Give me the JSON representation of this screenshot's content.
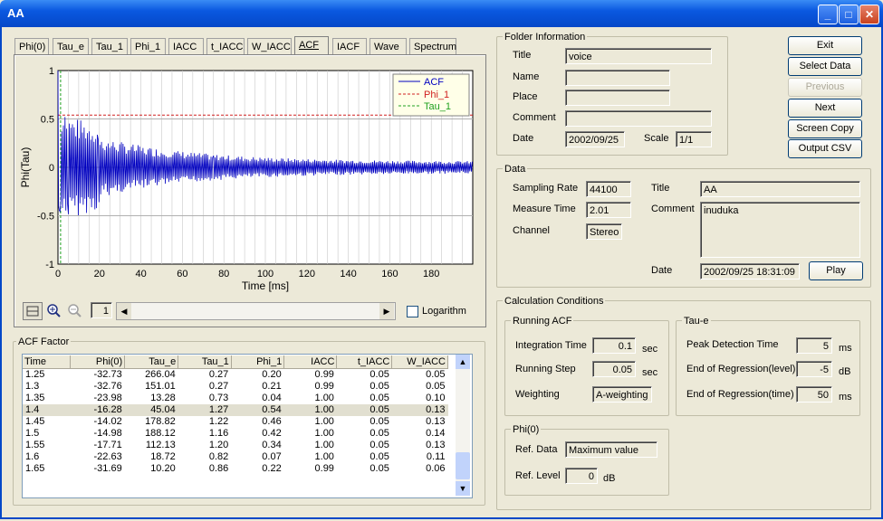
{
  "window": {
    "title": "AA"
  },
  "tabs": [
    "Phi(0)",
    "Tau_e",
    "Tau_1",
    "Phi_1",
    "IACC",
    "t_IACC",
    "W_IACC",
    "ACF",
    "IACF",
    "Wave",
    "Spectrum"
  ],
  "active_tab": "ACF",
  "chart_data": {
    "type": "line",
    "xlabel": "Time [ms]",
    "ylabel": "Phi(Tau)",
    "xlim": [
      0,
      200
    ],
    "ylim": [
      -1,
      1
    ],
    "xticks": [
      "0",
      "20",
      "40",
      "60",
      "80",
      "100",
      "120",
      "140",
      "160",
      "180"
    ],
    "yticks": [
      "1",
      "0.5",
      "0",
      "-0.5",
      "-1"
    ],
    "grid": true,
    "legend_position": "top-right",
    "series": [
      {
        "name": "ACF",
        "color": "#0000c0",
        "style": "solid",
        "description_envelope": {
          "start": 0.45,
          "decay_ms": 60,
          "oscillation_period_ms": 1.8
        }
      },
      {
        "name": "Phi_1",
        "color": "#d02020",
        "style": "dashed",
        "y": 0.54
      },
      {
        "name": "Tau_1",
        "color": "#20a020",
        "style": "dashed",
        "x": 1.27
      }
    ]
  },
  "toolbar": {
    "page_value": "1",
    "logarithm_label": "Logarithm"
  },
  "acf_factor": {
    "title": "ACF Factor",
    "columns": [
      "Time",
      "Phi(0)",
      "Tau_e",
      "Tau_1",
      "Phi_1",
      "IACC",
      "t_IACC",
      "W_IACC"
    ],
    "rows": [
      [
        "1.25",
        "-32.73",
        "266.04",
        "0.27",
        "0.20",
        "0.99",
        "0.05",
        "0.05"
      ],
      [
        "1.3",
        "-32.76",
        "151.01",
        "0.27",
        "0.21",
        "0.99",
        "0.05",
        "0.05"
      ],
      [
        "1.35",
        "-23.98",
        "13.28",
        "0.73",
        "0.04",
        "1.00",
        "0.05",
        "0.10"
      ],
      [
        "1.4",
        "-16.28",
        "45.04",
        "1.27",
        "0.54",
        "1.00",
        "0.05",
        "0.13"
      ],
      [
        "1.45",
        "-14.02",
        "178.82",
        "1.22",
        "0.46",
        "1.00",
        "0.05",
        "0.13"
      ],
      [
        "1.5",
        "-14.98",
        "188.12",
        "1.16",
        "0.42",
        "1.00",
        "0.05",
        "0.14"
      ],
      [
        "1.55",
        "-17.71",
        "112.13",
        "1.20",
        "0.34",
        "1.00",
        "0.05",
        "0.13"
      ],
      [
        "1.6",
        "-22.63",
        "18.72",
        "0.82",
        "0.07",
        "1.00",
        "0.05",
        "0.11"
      ],
      [
        "1.65",
        "-31.69",
        "10.20",
        "0.86",
        "0.22",
        "0.99",
        "0.05",
        "0.06"
      ]
    ],
    "selected_row": 3
  },
  "folder_info": {
    "title": "Folder Information",
    "title_label": "Title",
    "title_value": "voice",
    "name_label": "Name",
    "name_value": "",
    "place_label": "Place",
    "place_value": "",
    "comment_label": "Comment",
    "comment_value": "",
    "date_label": "Date",
    "date_value": "2002/09/25",
    "scale_label": "Scale",
    "scale_value": "1/1"
  },
  "buttons": {
    "exit": "Exit",
    "select_data": "Select Data",
    "previous": "Previous",
    "next": "Next",
    "screen_copy": "Screen Copy",
    "output_csv": "Output CSV",
    "play": "Play"
  },
  "data_section": {
    "title": "Data",
    "sampling_rate_label": "Sampling Rate",
    "sampling_rate": "44100",
    "measure_time_label": "Measure Time",
    "measure_time": "2.01",
    "channel_label": "Channel",
    "channel": "Stereo",
    "title_label": "Title",
    "title_value": "AA",
    "comment_label": "Comment",
    "comment_value": "inuduka",
    "date_label": "Date",
    "date_value": "2002/09/25 18:31:09"
  },
  "calc": {
    "title": "Calculation Conditions",
    "running_acf": {
      "title": "Running ACF",
      "integration_time_label": "Integration Time",
      "integration_time": "0.1",
      "integration_unit": "sec",
      "running_step_label": "Running Step",
      "running_step": "0.05",
      "running_step_unit": "sec",
      "weighting_label": "Weighting",
      "weighting": "A-weighting"
    },
    "tau_e": {
      "title": "Tau-e",
      "peak_label": "Peak Detection Time",
      "peak": "5",
      "peak_unit": "ms",
      "eor_level_label": "End of Regression(level)",
      "eor_level": "-5",
      "eor_level_unit": "dB",
      "eor_time_label": "End of Regression(time)",
      "eor_time": "50",
      "eor_time_unit": "ms"
    },
    "phi0": {
      "title": "Phi(0)",
      "ref_data_label": "Ref. Data",
      "ref_data": "Maximum value",
      "ref_level_label": "Ref. Level",
      "ref_level": "0",
      "ref_level_unit": "dB"
    }
  }
}
